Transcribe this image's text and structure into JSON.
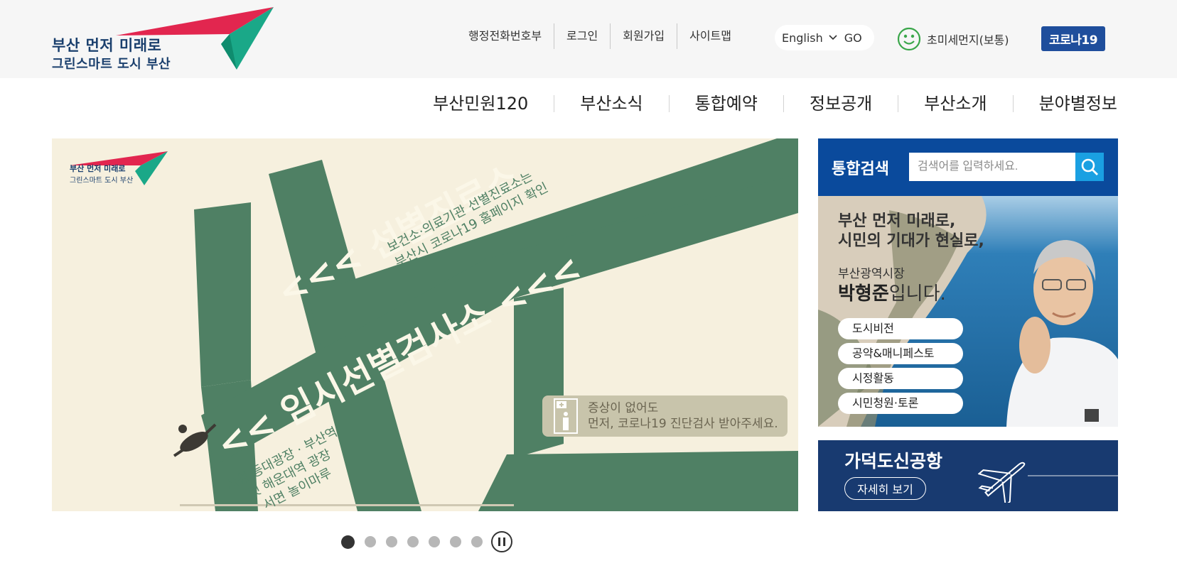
{
  "logo": {
    "line1": "부산 먼저 미래로",
    "line2": "그린스마트 도시 부산"
  },
  "util_links": [
    "행정전화번호부",
    "로그인",
    "회원가입",
    "사이트맵"
  ],
  "language": {
    "selected": "English",
    "go": "GO"
  },
  "fine_dust": {
    "label": "초미세먼지(보통)"
  },
  "corona_button": "코로나19",
  "main_nav": [
    "부산민원120",
    "부산소식",
    "통합예약",
    "정보공개",
    "부산소개",
    "분야별정보"
  ],
  "banner": {
    "mini_logo_line1": "부산 먼저 미래로",
    "mini_logo_line2": "그린스마트 도시 부산",
    "title1": "<<< 선별진료소",
    "subtitle1": "보건소·의료기관 선별진료소는\n부산시 코로나19 홈페이지 확인",
    "title2": "<< 임시선별검사소 <<<",
    "places": "시청 등대광장 · 부산역\n옛 해운대역 광장\n서면 놀이마루",
    "notice": "증상이 없어도\n먼저, 코로나19 진단검사 받아주세요."
  },
  "slider": {
    "total": 7,
    "active_index": 0
  },
  "search": {
    "label": "통합검색",
    "placeholder": "검색어를 입력하세요."
  },
  "mayor": {
    "headline": "부산 먼저 미래로,\n시민의 기대가 현실로,",
    "role": "부산광역시장",
    "name": "박형준",
    "name_suffix": "입니다.",
    "links": [
      "도시비전",
      "공약&매니페스토",
      "시정활동",
      "시민청원·토론"
    ]
  },
  "airport": {
    "title": "가덕도신공항",
    "button": "자세히 보기"
  },
  "colors": {
    "brand_navy": "#1a3f6d",
    "corona_btn": "#1f4e9c",
    "search_panel": "#0a4a9c",
    "search_btn": "#1aa0e2",
    "banner_bg": "#f6f0de",
    "banner_green": "#4f8064",
    "airport_bg": "#183a70",
    "logo_red": "#e2264f",
    "logo_teal": "#1aa888"
  }
}
